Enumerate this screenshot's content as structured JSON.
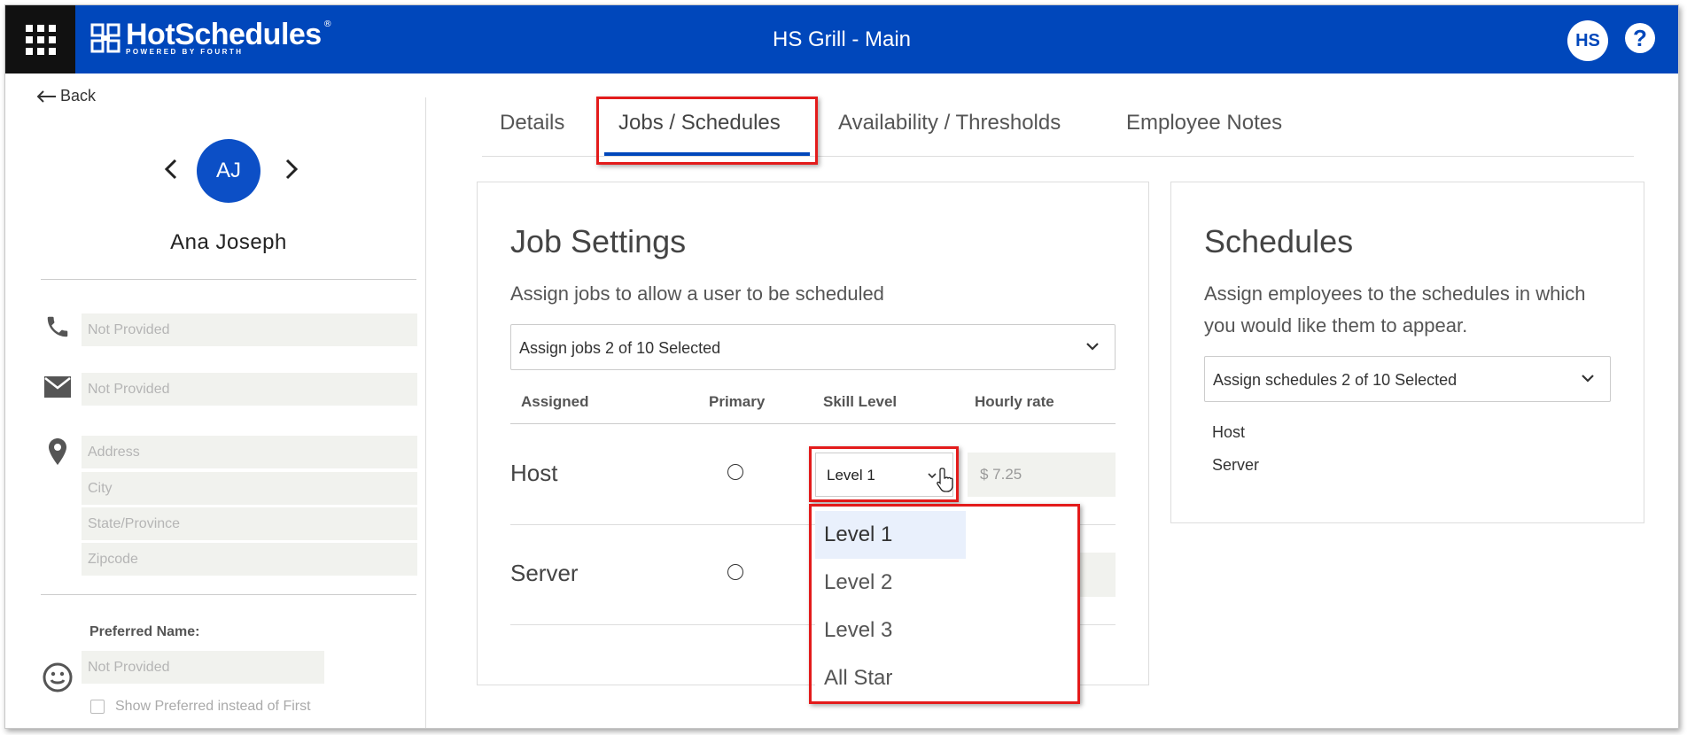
{
  "header": {
    "app_name": "HotSchedules",
    "app_tagline": "POWERED BY FOURTH",
    "store_name": "HS Grill - Main",
    "user_initials": "HS",
    "help_label": "?"
  },
  "left_panel": {
    "back_label": "Back",
    "employee_initials": "AJ",
    "employee_name": "Ana Joseph",
    "phone_placeholder": "Not Provided",
    "email_placeholder": "Not Provided",
    "address_placeholder": "Address",
    "city_placeholder": "City",
    "state_placeholder": "State/Province",
    "zip_placeholder": "Zipcode",
    "preferred_name_label": "Preferred Name:",
    "preferred_name_placeholder": "Not Provided",
    "show_preferred_label": "Show Preferred instead of First"
  },
  "tabs": [
    {
      "label": "Details"
    },
    {
      "label": "Jobs / Schedules"
    },
    {
      "label": "Availability / Thresholds"
    },
    {
      "label": "Employee Notes"
    }
  ],
  "job_settings": {
    "title": "Job Settings",
    "description": "Assign jobs to allow a user to be scheduled",
    "assign_select": "Assign jobs 2 of 10 Selected",
    "columns": [
      "Assigned",
      "Primary",
      "Skill Level",
      "Hourly rate"
    ],
    "rows": [
      {
        "job": "Host",
        "skill_level": "Level 1",
        "hourly_rate": "$ 7.25"
      },
      {
        "job": "Server",
        "skill_level": "",
        "hourly_rate": ""
      }
    ],
    "skill_options": [
      "Level 1",
      "Level 2",
      "Level 3",
      "All Star"
    ]
  },
  "schedules": {
    "title": "Schedules",
    "description": "Assign employees to the schedules in which you would like them to appear.",
    "assign_select": "Assign schedules 2 of 10 Selected",
    "items": [
      "Host",
      "Server"
    ]
  },
  "colors": {
    "brand_blue": "#0047bb",
    "highlight_red": "#e31b1b"
  }
}
